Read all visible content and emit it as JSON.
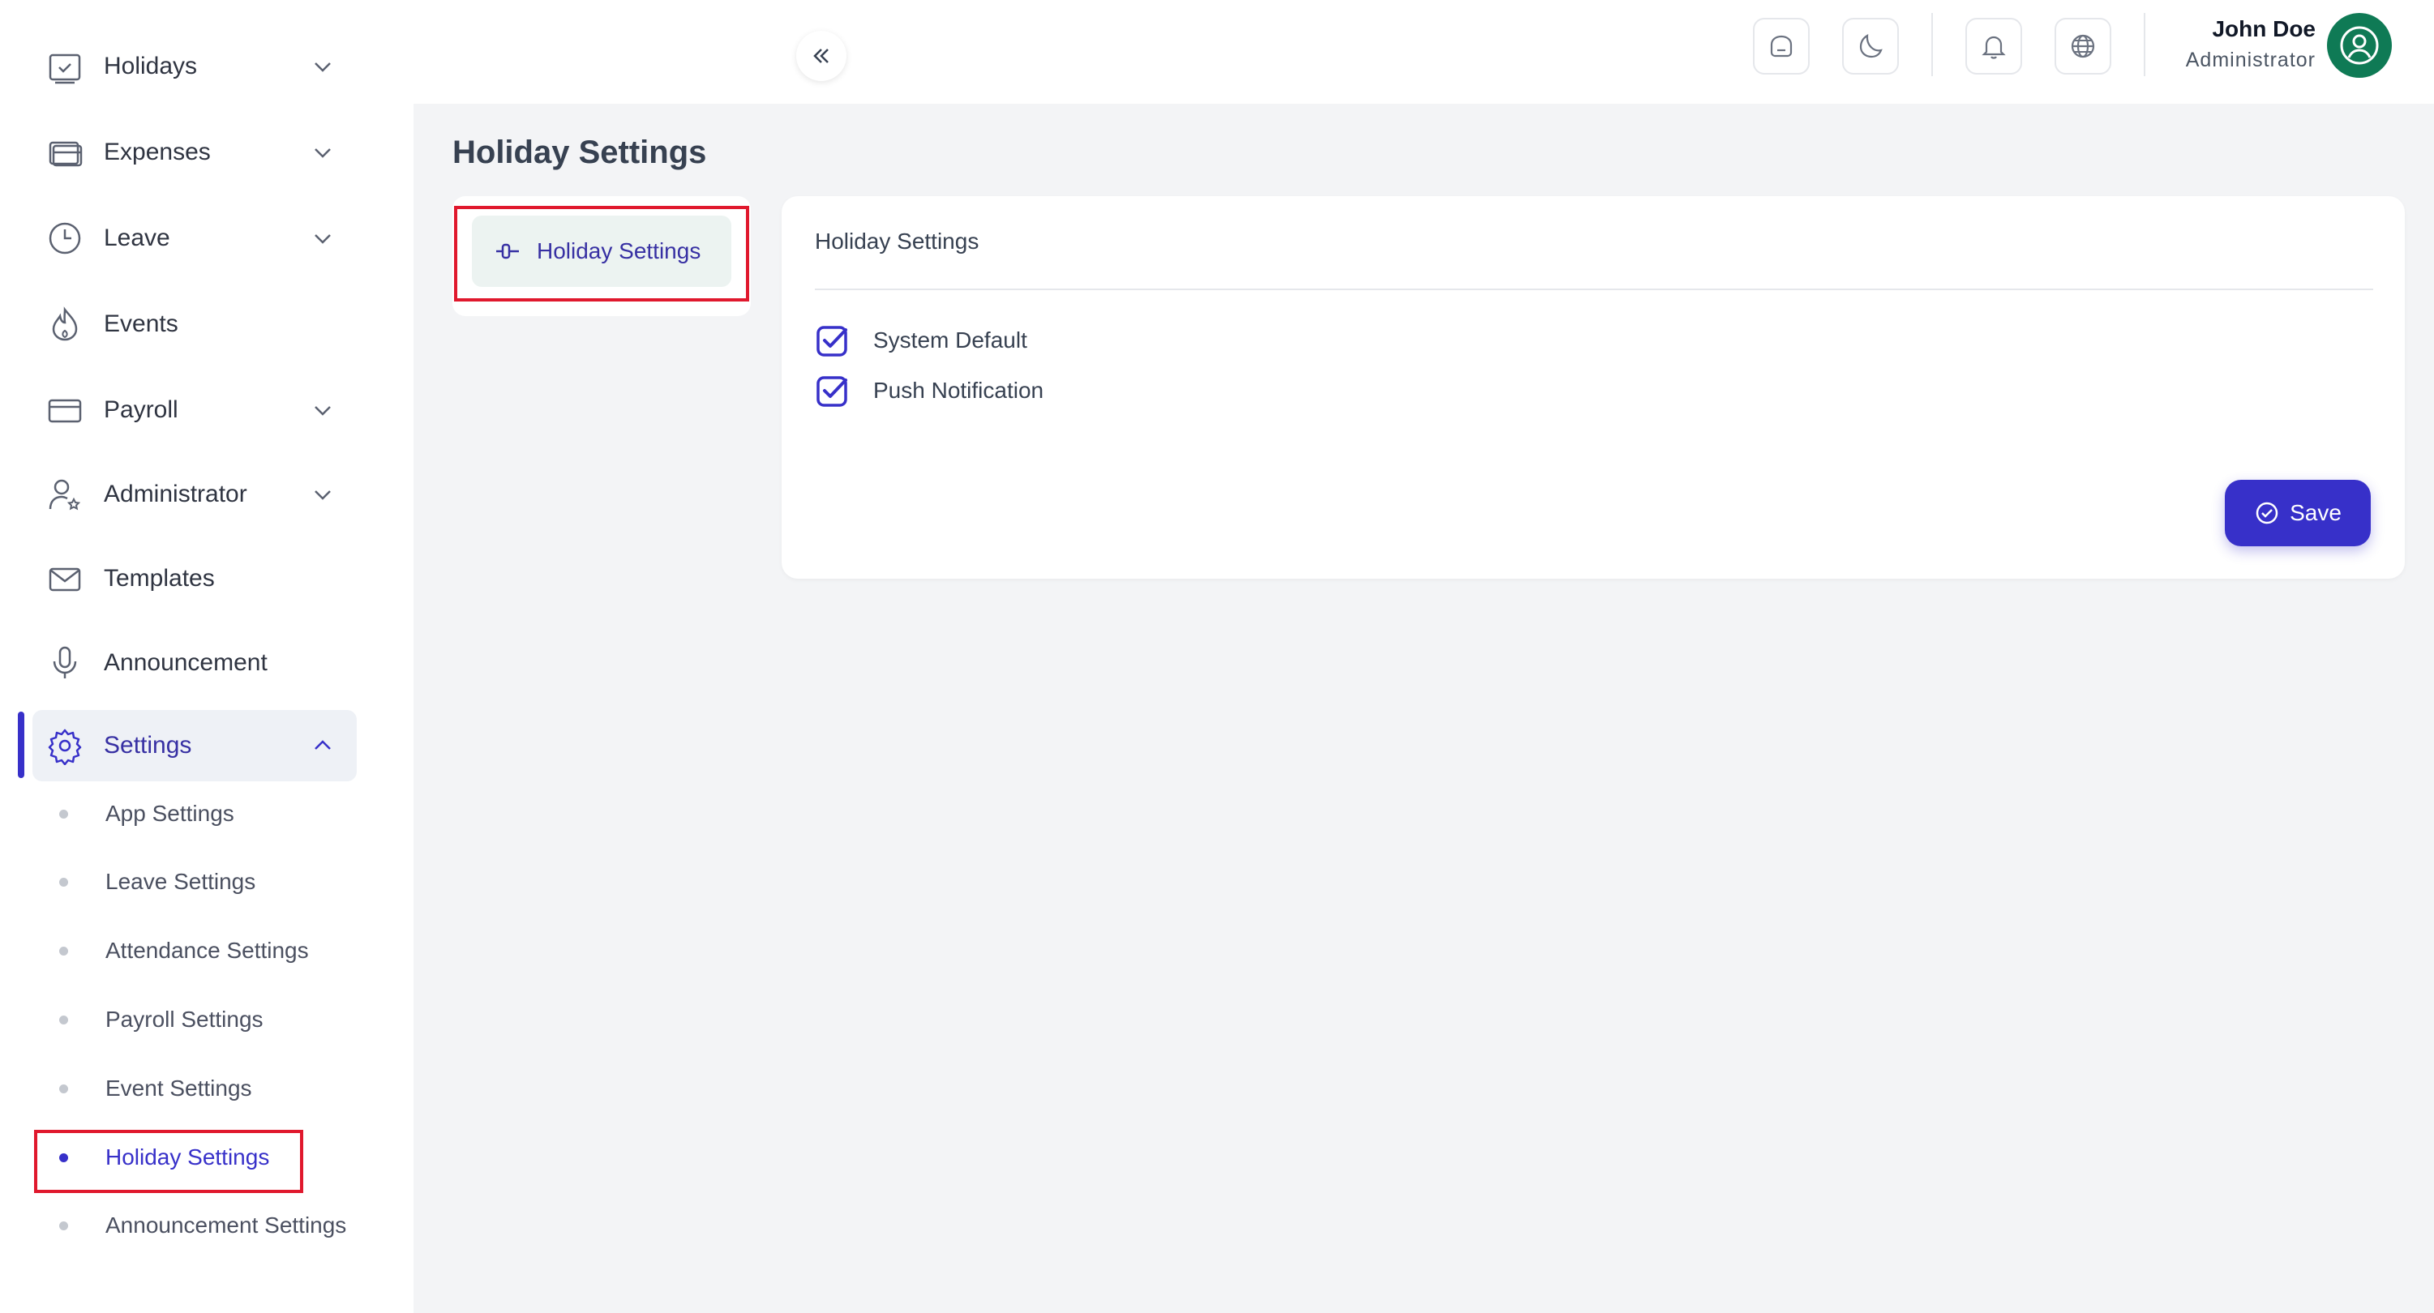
{
  "sidebar": {
    "items": [
      {
        "label": "Holidays"
      },
      {
        "label": "Expenses"
      },
      {
        "label": "Leave"
      },
      {
        "label": "Events"
      },
      {
        "label": "Payroll"
      },
      {
        "label": "Administrator"
      },
      {
        "label": "Templates"
      },
      {
        "label": "Announcement"
      },
      {
        "label": "Settings"
      }
    ],
    "sub_items": [
      {
        "label": "App Settings"
      },
      {
        "label": "Leave Settings"
      },
      {
        "label": "Attendance Settings"
      },
      {
        "label": "Payroll Settings"
      },
      {
        "label": "Event Settings"
      },
      {
        "label": "Holiday Settings"
      },
      {
        "label": "Announcement Settings"
      }
    ]
  },
  "header": {
    "user_name": "John Doe",
    "user_role": "Administrator"
  },
  "main": {
    "page_title": "Holiday Settings",
    "side_tab_label": "Holiday Settings",
    "card_title": "Holiday Settings",
    "options": [
      {
        "label": "System Default",
        "checked": true
      },
      {
        "label": "Push Notification",
        "checked": true
      }
    ],
    "save_label": "Save"
  },
  "colors": {
    "accent": "#3730c9",
    "highlight": "#e0182d",
    "avatar": "#0f7a55"
  }
}
